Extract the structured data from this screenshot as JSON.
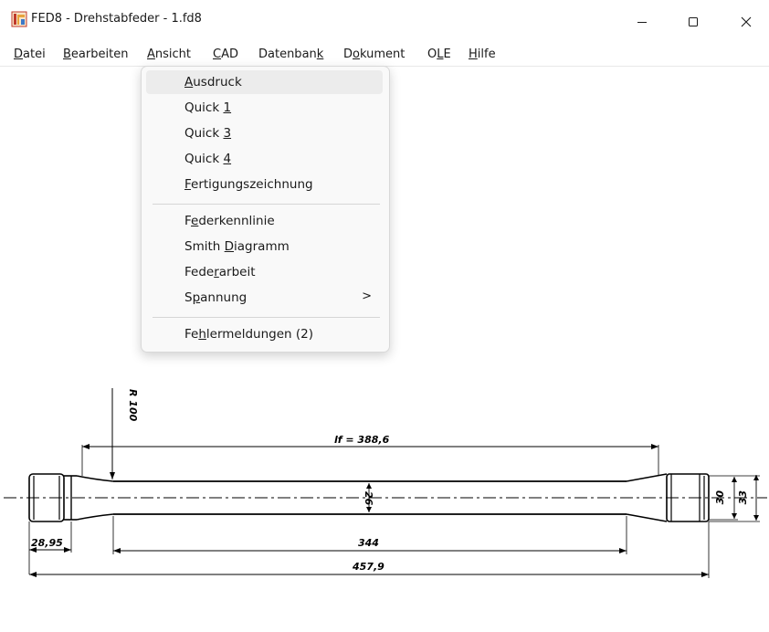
{
  "window": {
    "title": "FED8 - Drehstabfeder  -  1.fd8",
    "controls": {
      "minimize": "—",
      "maximize": "☐",
      "close": "✕"
    }
  },
  "menubar": {
    "items": [
      {
        "pre": "",
        "u": "D",
        "post": "atei"
      },
      {
        "pre": "",
        "u": "B",
        "post": "earbeiten"
      },
      {
        "pre": "",
        "u": "A",
        "post": "nsicht"
      },
      {
        "pre": "",
        "u": "C",
        "post": "AD"
      },
      {
        "pre": "Datenban",
        "u": "k",
        "post": ""
      },
      {
        "pre": "D",
        "u": "o",
        "post": "kument"
      },
      {
        "pre": "O",
        "u": "L",
        "post": "E"
      },
      {
        "pre": "",
        "u": "H",
        "post": "ilfe"
      }
    ]
  },
  "dropdown": {
    "items": [
      {
        "pre": "",
        "u": "A",
        "post": "usdruck"
      },
      {
        "pre": "Quick ",
        "u": "1",
        "post": ""
      },
      {
        "pre": "Quick ",
        "u": "3",
        "post": ""
      },
      {
        "pre": "Quick ",
        "u": "4",
        "post": ""
      },
      {
        "pre": "",
        "u": "F",
        "post": "ertigungszeichnung"
      },
      {
        "pre": "F",
        "u": "e",
        "post": "derkennlinie"
      },
      {
        "pre": "Smith ",
        "u": "D",
        "post": "iagramm"
      },
      {
        "pre": "Fede",
        "u": "r",
        "post": "arbeit"
      },
      {
        "pre": "S",
        "u": "p",
        "post": "annung"
      },
      {
        "pre": "Fe",
        "u": "h",
        "post": "lermeldungen (2)"
      }
    ],
    "submenu_arrow": ">"
  },
  "drawing": {
    "radius_label": "R 100",
    "lf_label": "lf = 388,6",
    "diameter_label": "26",
    "d30_label": "30",
    "d33_label": "33",
    "head_len_label": "28,95",
    "shaft_len_label": "344",
    "total_len_label": "457,9"
  },
  "colors": {
    "highlight": "#ececec",
    "menu_bg": "#f9f9f9",
    "icon_red": "#c0392b",
    "icon_orange": "#e8a33d"
  }
}
